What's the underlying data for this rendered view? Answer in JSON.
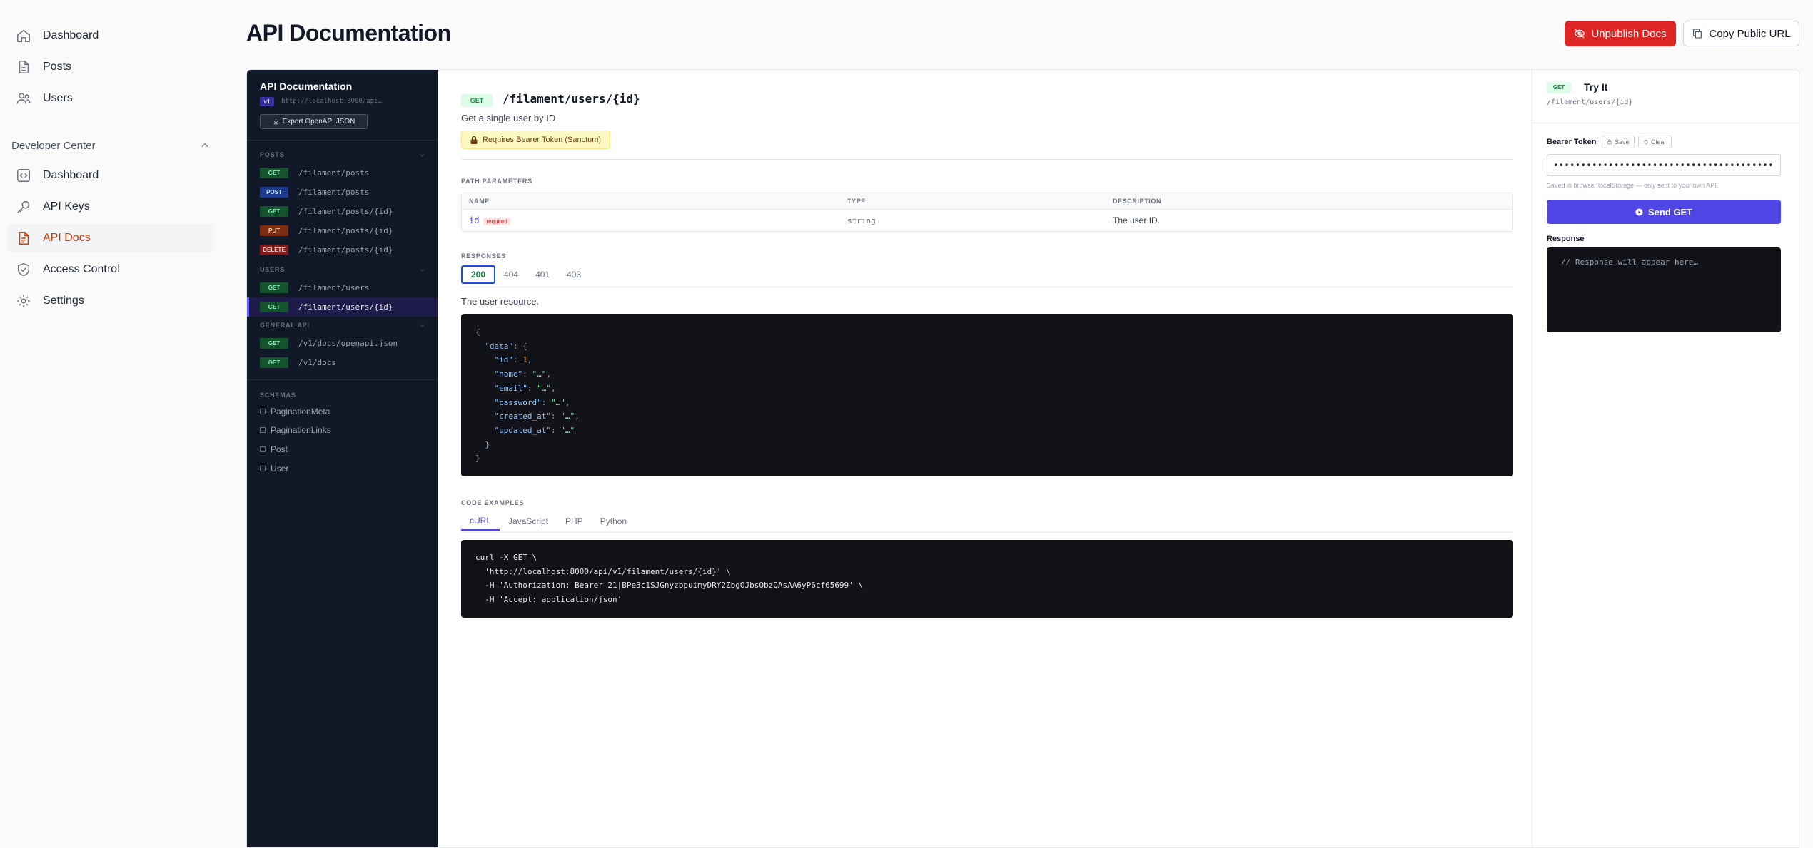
{
  "sidebar": {
    "items": [
      {
        "label": "Dashboard",
        "icon": "home-icon"
      },
      {
        "label": "Posts",
        "icon": "document-icon"
      },
      {
        "label": "Users",
        "icon": "users-icon"
      }
    ],
    "group": {
      "label": "Developer Center",
      "items": [
        {
          "label": "Dashboard",
          "icon": "code-bracket-icon"
        },
        {
          "label": "API Keys",
          "icon": "key-icon"
        },
        {
          "label": "API Docs",
          "icon": "document-text-icon",
          "active": true
        },
        {
          "label": "Access Control",
          "icon": "shield-check-icon"
        },
        {
          "label": "Settings",
          "icon": "cog-icon"
        }
      ]
    }
  },
  "header": {
    "title": "API Documentation",
    "unpublish_label": "Unpublish Docs",
    "copy_label": "Copy Public URL"
  },
  "docs_nav": {
    "title": "API Documentation",
    "version": "v1",
    "base_url": "http://localhost:8000/api…",
    "export_label": "Export OpenAPI JSON",
    "sections": [
      {
        "label": "POSTS",
        "endpoints": [
          {
            "method": "GET",
            "path": "/filament/posts"
          },
          {
            "method": "POST",
            "path": "/filament/posts"
          },
          {
            "method": "GET",
            "path": "/filament/posts/{id}"
          },
          {
            "method": "PUT",
            "path": "/filament/posts/{id}"
          },
          {
            "method": "DELETE",
            "path": "/filament/posts/{id}"
          }
        ]
      },
      {
        "label": "USERS",
        "endpoints": [
          {
            "method": "GET",
            "path": "/filament/users"
          },
          {
            "method": "GET",
            "path": "/filament/users/{id}",
            "active": true
          }
        ]
      },
      {
        "label": "GENERAL API",
        "endpoints": [
          {
            "method": "GET",
            "path": "/v1/docs/openapi.json"
          },
          {
            "method": "GET",
            "path": "/v1/docs"
          }
        ]
      }
    ],
    "schemas_label": "SCHEMAS",
    "schemas": [
      "PaginationMeta",
      "PaginationLinks",
      "Post",
      "User"
    ]
  },
  "endpoint": {
    "method": "GET",
    "path": "/filament/users/{id}",
    "summary": "Get a single user by ID",
    "auth": "Requires Bearer Token (Sanctum)"
  },
  "params": {
    "section_label": "PATH PARAMETERS",
    "headers": [
      "NAME",
      "TYPE",
      "DESCRIPTION"
    ],
    "rows": [
      {
        "name": "id",
        "required": "required",
        "type": "string",
        "description": "The user ID."
      }
    ]
  },
  "responses": {
    "section_label": "RESPONSES",
    "tabs": [
      "200",
      "404",
      "401",
      "403"
    ],
    "active": "200",
    "description": "The user resource.",
    "code_lines": [
      "{",
      "  \"data\": {",
      "    \"id\": 1,",
      "    \"name\": \"…\",",
      "    \"email\": \"…\",",
      "    \"password\": \"…\",",
      "    \"created_at\": \"…\",",
      "    \"updated_at\": \"…\"",
      "  }",
      "}"
    ]
  },
  "code_examples": {
    "section_label": "CODE EXAMPLES",
    "tabs": [
      "cURL",
      "JavaScript",
      "PHP",
      "Python"
    ],
    "active": "cURL",
    "code_lines": [
      "curl -X GET \\",
      "  'http://localhost:8000/api/v1/filament/users/{id}' \\",
      "  -H 'Authorization: Bearer 21|BPe3c1SJGnyzbpuimyDRY2ZbgOJbsQbzQAsAA6yP6cf65699' \\",
      "  -H 'Accept: application/json'"
    ]
  },
  "try_it": {
    "method": "GET",
    "title": "Try It",
    "path": "/filament/users/{id}",
    "token_label": "Bearer Token",
    "save_label": "Save",
    "clear_label": "Clear",
    "token_value": "••••••••••••••••••••••••••••••••••••••••••••••••••••",
    "note": "Saved in browser localStorage — only sent to your own API.",
    "send_label": "Send GET",
    "response_label": "Response",
    "response_placeholder": "// Response will appear here…"
  },
  "colors": {
    "accent": "#4f46e5",
    "danger": "#dc2626",
    "active_nav": "#c2410c",
    "nav_bg": "#111827"
  }
}
